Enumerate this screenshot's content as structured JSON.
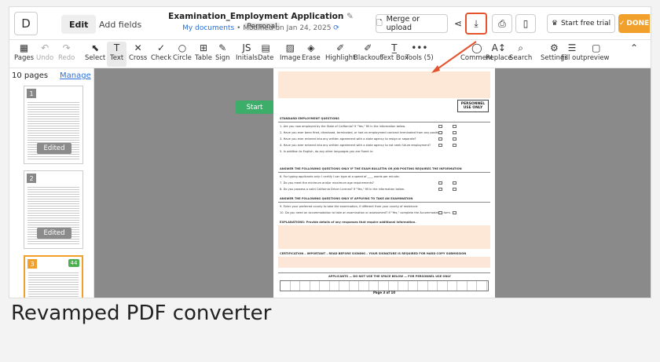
{
  "app": {
    "logo_letter": "D",
    "tab_edit": "Edit",
    "tab_fields": "Add fields"
  },
  "document": {
    "title": "Examination_Employment Application",
    "tag": "Personal",
    "folder": "My documents",
    "modified": "Modified on Jan 24, 2025"
  },
  "topbar": {
    "merge_label": "Merge or upload",
    "trial_label": "Start free trial",
    "done_label": "DONE"
  },
  "toolbar": {
    "items": [
      {
        "label": "Pages",
        "icon": "pages-icon",
        "glyph": "▦"
      },
      {
        "label": "Undo",
        "icon": "undo-icon",
        "glyph": "↶"
      },
      {
        "label": "Redo",
        "icon": "redo-icon",
        "glyph": "↷"
      },
      {
        "label": "Select",
        "icon": "cursor-icon",
        "glyph": "⬉"
      },
      {
        "label": "Text",
        "icon": "text-icon",
        "glyph": "T"
      },
      {
        "label": "Cross",
        "icon": "cross-icon",
        "glyph": "✕"
      },
      {
        "label": "Check",
        "icon": "check-icon",
        "glyph": "✓"
      },
      {
        "label": "Circle",
        "icon": "circle-icon",
        "glyph": "○"
      },
      {
        "label": "Table",
        "icon": "table-icon",
        "glyph": "⊞"
      },
      {
        "label": "Sign",
        "icon": "sign-icon",
        "glyph": "✎"
      },
      {
        "label": "Initials",
        "icon": "initials-icon",
        "glyph": "JS"
      },
      {
        "label": "Date",
        "icon": "date-icon",
        "glyph": "▤"
      },
      {
        "label": "Image",
        "icon": "image-icon",
        "glyph": "▨"
      },
      {
        "label": "Erase",
        "icon": "erase-icon",
        "glyph": "◈"
      },
      {
        "label": "Highlight",
        "icon": "highlight-icon",
        "glyph": "✐"
      },
      {
        "label": "Blackout",
        "icon": "blackout-icon",
        "glyph": "✐"
      },
      {
        "label": "Text Box",
        "icon": "textbox-icon",
        "glyph": "T̲"
      },
      {
        "label": "Tools (5)",
        "icon": "tools-icon",
        "glyph": "•••"
      },
      {
        "label": "Comment",
        "icon": "comment-icon",
        "glyph": "◯"
      },
      {
        "label": "Replace",
        "icon": "replace-icon",
        "glyph": "A↕"
      },
      {
        "label": "Search",
        "icon": "search-icon",
        "glyph": "⌕"
      },
      {
        "label": "Settings",
        "icon": "settings-icon",
        "glyph": "⚙"
      },
      {
        "label": "Fill out",
        "icon": "fillout-icon",
        "glyph": "☰"
      },
      {
        "label": "preview",
        "icon": "preview-icon",
        "glyph": "▢"
      }
    ]
  },
  "sidebar": {
    "pages_count": "10 pages",
    "manage_label": "Manage",
    "thumbs": [
      {
        "num": "1",
        "edited": "Edited"
      },
      {
        "num": "2",
        "edited": "Edited"
      },
      {
        "num": "3",
        "badge": "44"
      }
    ]
  },
  "canvas": {
    "start_label": "Start",
    "page_text": {
      "personnel": "PERSONNEL USE ONLY",
      "sec1": "STANDARD EMPLOYMENT QUESTIONS",
      "sec2": "ANSWER THE FOLLOWING QUESTIONS ONLY IF THE EXAM BULLETIN OR JOB POSTING REQUIRES THE INFORMATION",
      "sec3": "ANSWER THE FOLLOWING QUESTIONS ONLY IF APPLYING TO TAKE AN EXAMINATION",
      "explanations": "EXPLANATIONS: Provide details of any responses that require additional information.",
      "cert": "CERTIFICATION – IMPORTANT – READ BEFORE SIGNING – YOUR SIGNATURE IS REQUIRED FOR HARD COPY SUBMISSION",
      "applicants": "APPLICANTS — DO NOT USE THE SPACE BELOW — FOR PERSONNEL USE ONLY",
      "footer": "Page 3 of 10"
    }
  },
  "caption": "Revamped PDF converter"
}
